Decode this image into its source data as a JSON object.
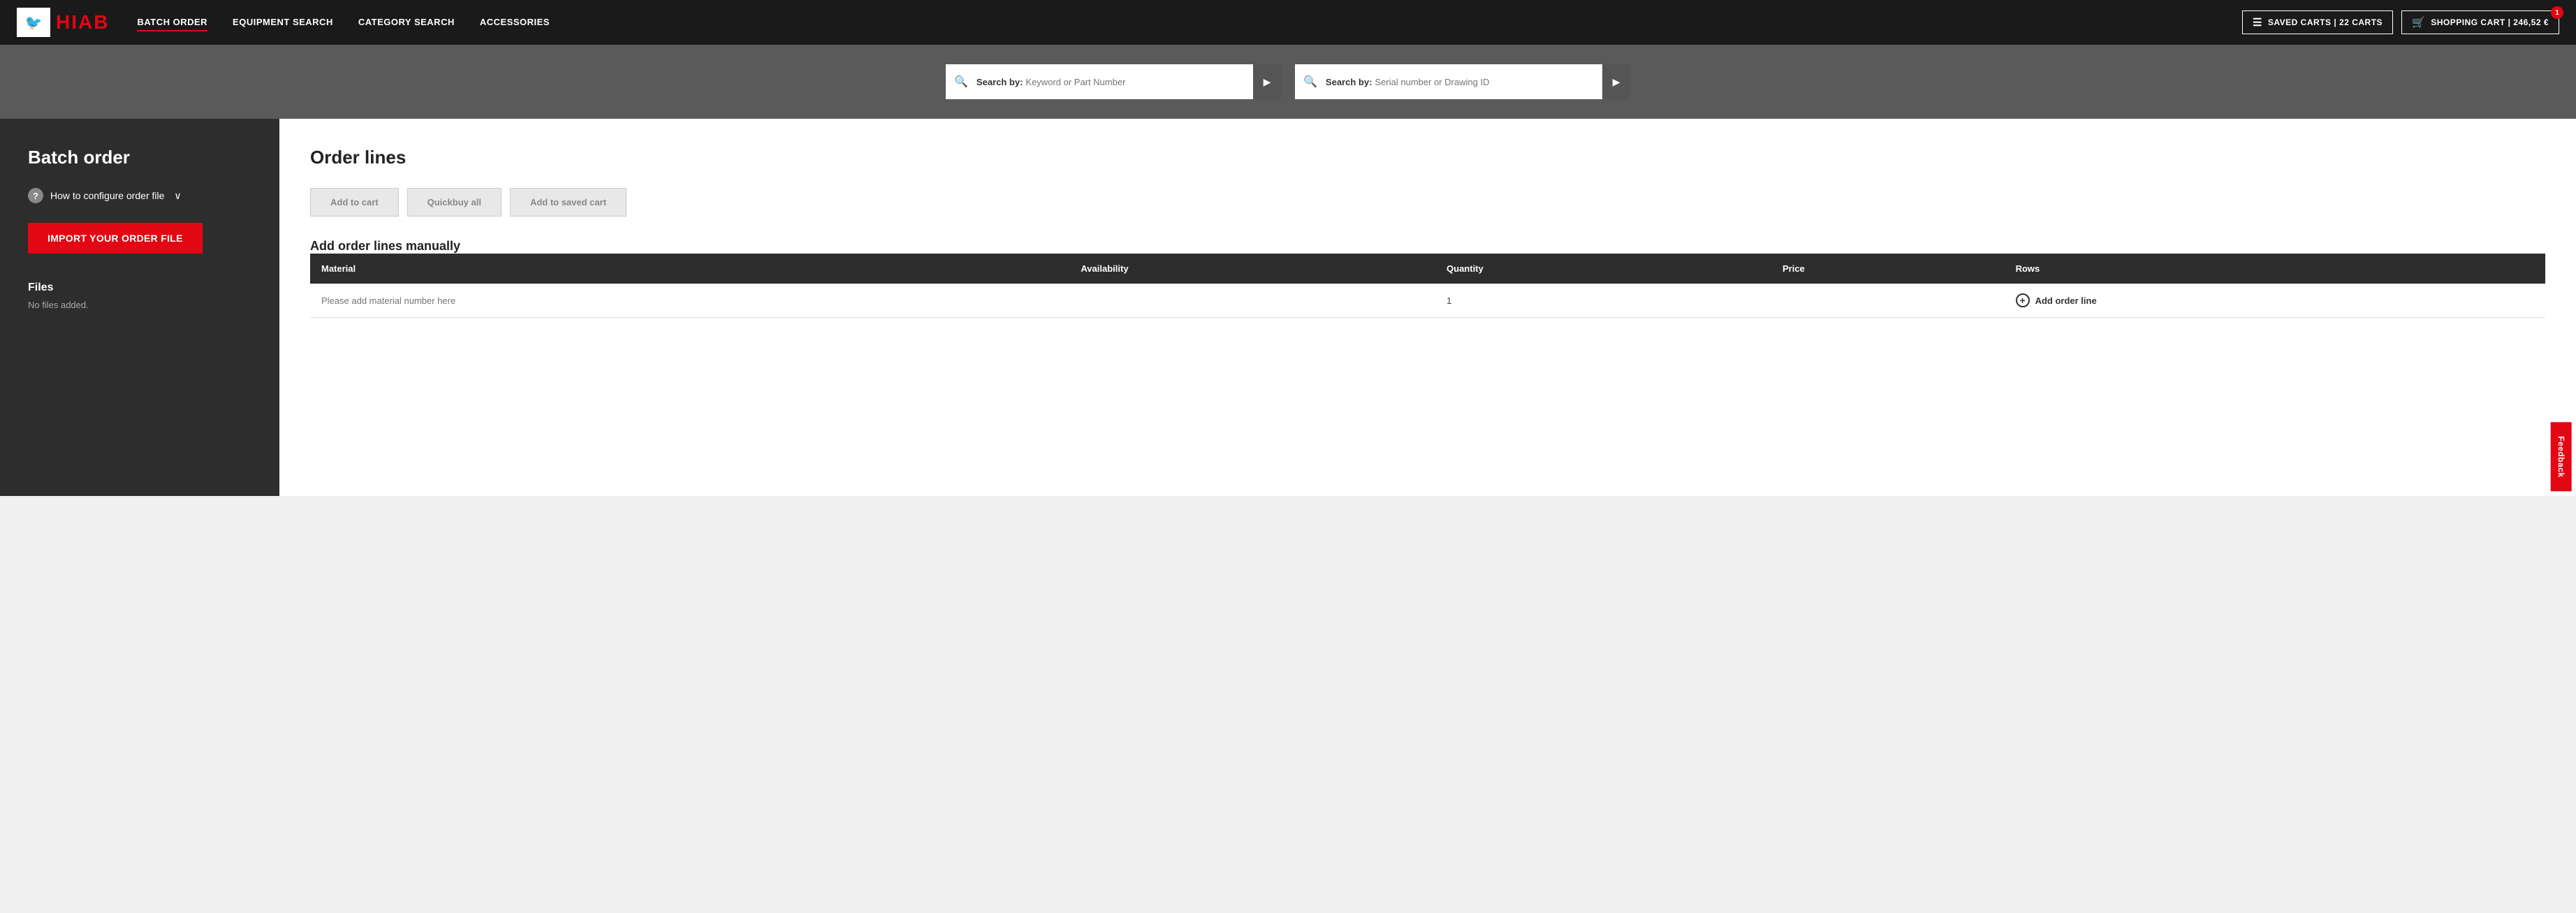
{
  "navbar": {
    "logo_text": "HIAB",
    "nav_links": [
      {
        "label": "BATCH ORDER",
        "active": true
      },
      {
        "label": "EQUIPMENT SEARCH",
        "active": false
      },
      {
        "label": "CATEGORY SEARCH",
        "active": false
      },
      {
        "label": "ACCESSORIES",
        "active": false
      }
    ],
    "saved_carts_label": "SAVED CARTS | 22 CARTS",
    "shopping_cart_label": "SHOPPING CART | 246,52 €",
    "cart_badge": "1"
  },
  "search_bar": {
    "search1_label": "Search by:",
    "search1_placeholder": "Keyword or Part Number",
    "search2_label": "Search by:",
    "search2_placeholder": "Serial number or Drawing ID"
  },
  "sidebar": {
    "title": "Batch order",
    "configure_label": "How to configure order file",
    "import_label": "Import your order file",
    "files_title": "Files",
    "files_empty": "No files added."
  },
  "order_panel": {
    "title": "Order lines",
    "add_to_cart_label": "Add to cart",
    "quickbuy_label": "Quickbuy all",
    "add_to_saved_cart_label": "Add to saved cart",
    "add_manually_title": "Add order lines manually",
    "table_headers": [
      "Material",
      "Availability",
      "Quantity",
      "Price",
      "Rows"
    ],
    "material_placeholder": "Please add material number here",
    "quantity_default": "1",
    "add_order_line_label": "Add order line"
  },
  "feedback": {
    "label": "Feedback"
  }
}
